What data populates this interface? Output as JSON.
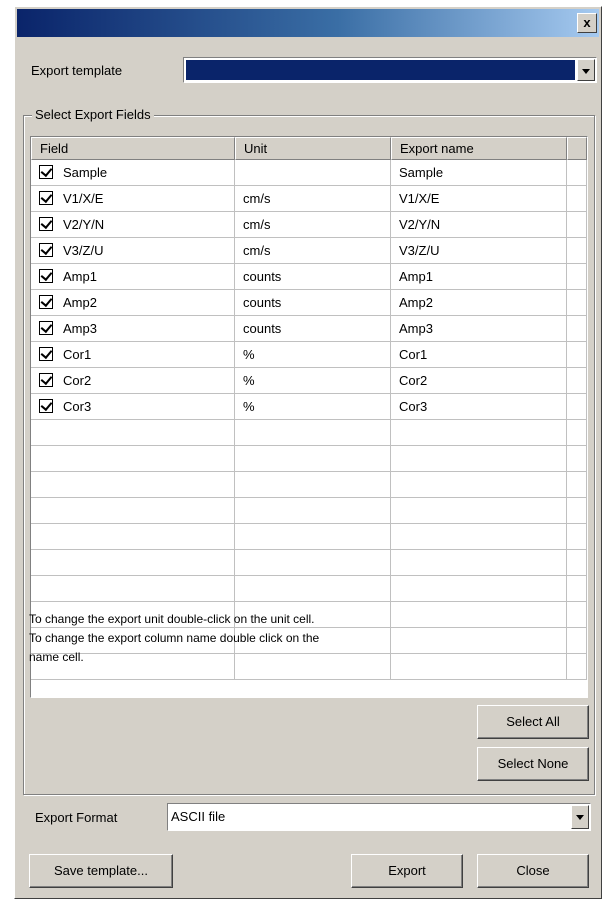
{
  "window": {
    "close_glyph": "x"
  },
  "template": {
    "label": "Export template",
    "value": ""
  },
  "group": {
    "title": "Select Export Fields"
  },
  "table": {
    "headers": [
      "Field",
      "Unit",
      "Export name"
    ],
    "rows": [
      {
        "field": "Sample",
        "unit": "",
        "export": "Sample",
        "checked": true
      },
      {
        "field": "V1/X/E",
        "unit": "cm/s",
        "export": "V1/X/E",
        "checked": true
      },
      {
        "field": "V2/Y/N",
        "unit": "cm/s",
        "export": "V2/Y/N",
        "checked": true
      },
      {
        "field": "V3/Z/U",
        "unit": "cm/s",
        "export": "V3/Z/U",
        "checked": true
      },
      {
        "field": "Amp1",
        "unit": "counts",
        "export": "Amp1",
        "checked": true
      },
      {
        "field": "Amp2",
        "unit": "counts",
        "export": "Amp2",
        "checked": true
      },
      {
        "field": "Amp3",
        "unit": "counts",
        "export": "Amp3",
        "checked": true
      },
      {
        "field": "Cor1",
        "unit": "%",
        "export": "Cor1",
        "checked": true
      },
      {
        "field": "Cor2",
        "unit": "%",
        "export": "Cor2",
        "checked": true
      },
      {
        "field": "Cor3",
        "unit": "%",
        "export": "Cor3",
        "checked": true
      }
    ]
  },
  "hint": "To change the export unit double-click on the unit cell.\nTo change the export column name double click on the\nname cell.",
  "buttons": {
    "select_all": "Select All",
    "select_none": "Select None",
    "save_template": "Save template...",
    "export": "Export",
    "close": "Close"
  },
  "format": {
    "label": "Export Format",
    "value": "ASCII file"
  },
  "colors": {
    "selection": "#0a246a",
    "face": "#d4d0c8"
  }
}
